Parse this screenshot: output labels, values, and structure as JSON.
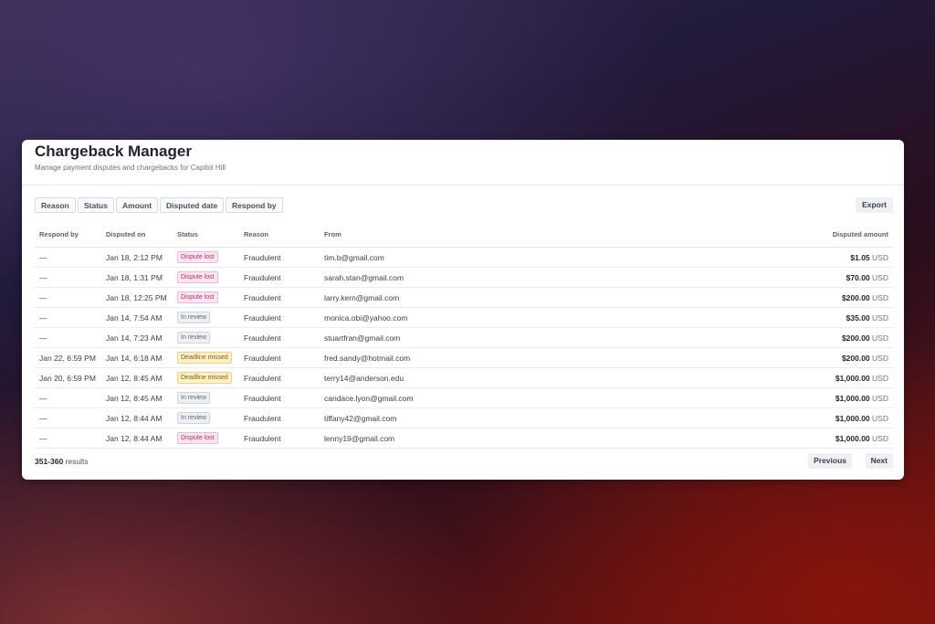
{
  "app": {
    "title": "Chargeback Manager",
    "subtitle": "Manage payment disputes and chargebacks for Capitol Hill"
  },
  "toolbar": {
    "filters": [
      "Reason",
      "Status",
      "Amount",
      "Disputed date",
      "Respond by"
    ],
    "export_label": "Export"
  },
  "table": {
    "columns": [
      "Respond by",
      "Disputed on",
      "Status",
      "Reason",
      "From",
      "Disputed amount"
    ],
    "rows": [
      {
        "respond_by": "—",
        "disputed_on": "Jan 18, 2:12 PM",
        "status": "Dispute lost",
        "status_type": "lost",
        "reason": "Fraudulent",
        "from": "tim.b@gmail.com",
        "amount": "$1.05",
        "currency": "USD"
      },
      {
        "respond_by": "—",
        "disputed_on": "Jan 18, 1:31 PM",
        "status": "Dispute lost",
        "status_type": "lost",
        "reason": "Fraudulent",
        "from": "sarah.stan@gmail.com",
        "amount": "$70.00",
        "currency": "USD"
      },
      {
        "respond_by": "—",
        "disputed_on": "Jan 18, 12:25 PM",
        "status": "Dispute lost",
        "status_type": "lost",
        "reason": "Fraudulent",
        "from": "larry.kern@gmail.com",
        "amount": "$200.00",
        "currency": "USD"
      },
      {
        "respond_by": "—",
        "disputed_on": "Jan 14, 7:54 AM",
        "status": "In review",
        "status_type": "review",
        "reason": "Fraudulent",
        "from": "monica.obi@yahoo.com",
        "amount": "$35.00",
        "currency": "USD"
      },
      {
        "respond_by": "—",
        "disputed_on": "Jan 14, 7:23 AM",
        "status": "In review",
        "status_type": "review",
        "reason": "Fraudulent",
        "from": "stuartfran@gmail.com",
        "amount": "$200.00",
        "currency": "USD"
      },
      {
        "respond_by": "Jan 22, 6:59 PM",
        "disputed_on": "Jan 14, 6:18 AM",
        "status": "Deadline missed",
        "status_type": "missed",
        "reason": "Fraudulent",
        "from": "fred.sandy@hotmail.com",
        "amount": "$200.00",
        "currency": "USD"
      },
      {
        "respond_by": "Jan 20, 6:59 PM",
        "disputed_on": "Jan 12, 8:45 AM",
        "status": "Deadline missed",
        "status_type": "missed",
        "reason": "Fraudulent",
        "from": "terry14@anderson.edu",
        "amount": "$1,000.00",
        "currency": "USD"
      },
      {
        "respond_by": "—",
        "disputed_on": "Jan 12, 8:45 AM",
        "status": "In review",
        "status_type": "review",
        "reason": "Fraudulent",
        "from": "candace.lyon@gmail.com",
        "amount": "$1,000.00",
        "currency": "USD"
      },
      {
        "respond_by": "—",
        "disputed_on": "Jan 12, 8:44 AM",
        "status": "In review",
        "status_type": "review",
        "reason": "Fraudulent",
        "from": "tiffany42@gmail.com",
        "amount": "$1,000.00",
        "currency": "USD"
      },
      {
        "respond_by": "—",
        "disputed_on": "Jan 12, 8:44 AM",
        "status": "Dispute lost",
        "status_type": "lost",
        "reason": "Fraudulent",
        "from": "lenny19@gmail.com",
        "amount": "$1,000.00",
        "currency": "USD"
      }
    ]
  },
  "footer": {
    "range": "351-360",
    "results_label": "results",
    "previous_label": "Previous",
    "next_label": "Next"
  }
}
